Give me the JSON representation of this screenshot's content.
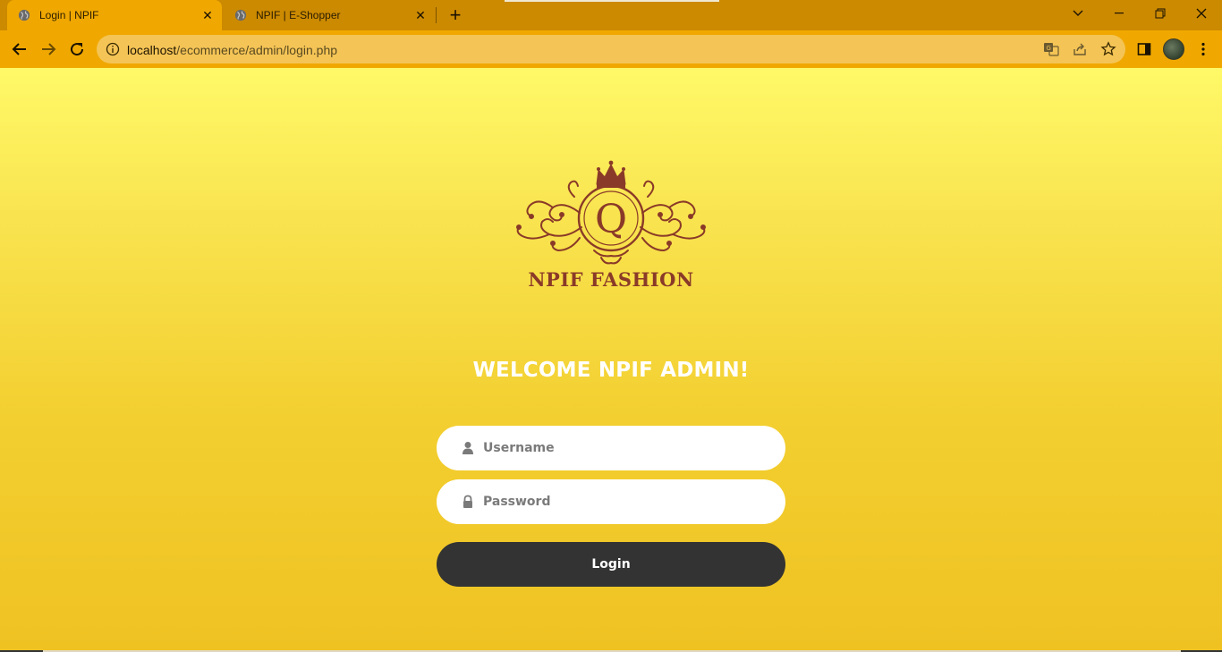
{
  "browser": {
    "tabs": [
      {
        "title": "Login | NPIF",
        "active": true
      },
      {
        "title": "NPIF | E-Shopper",
        "active": false
      }
    ],
    "url_host": "localhost",
    "url_path": "/ecommerce/admin/login.php"
  },
  "brand": {
    "name": "NPIF FASHION",
    "logo_letter": "Q"
  },
  "login": {
    "heading": "WELCOME NPIF ADMIN!",
    "username_placeholder": "Username",
    "password_placeholder": "Password",
    "submit_label": "Login"
  },
  "colors": {
    "chrome_tabbar": "#cc8a00",
    "chrome_toolbar": "#f0a800",
    "page_gradient_top": "#fff968",
    "page_gradient_bottom": "#efc222",
    "logo": "#8a3a28",
    "button": "#333333"
  },
  "icons": {
    "tab": "globe-icon",
    "username": "user-icon",
    "password": "lock-icon"
  }
}
